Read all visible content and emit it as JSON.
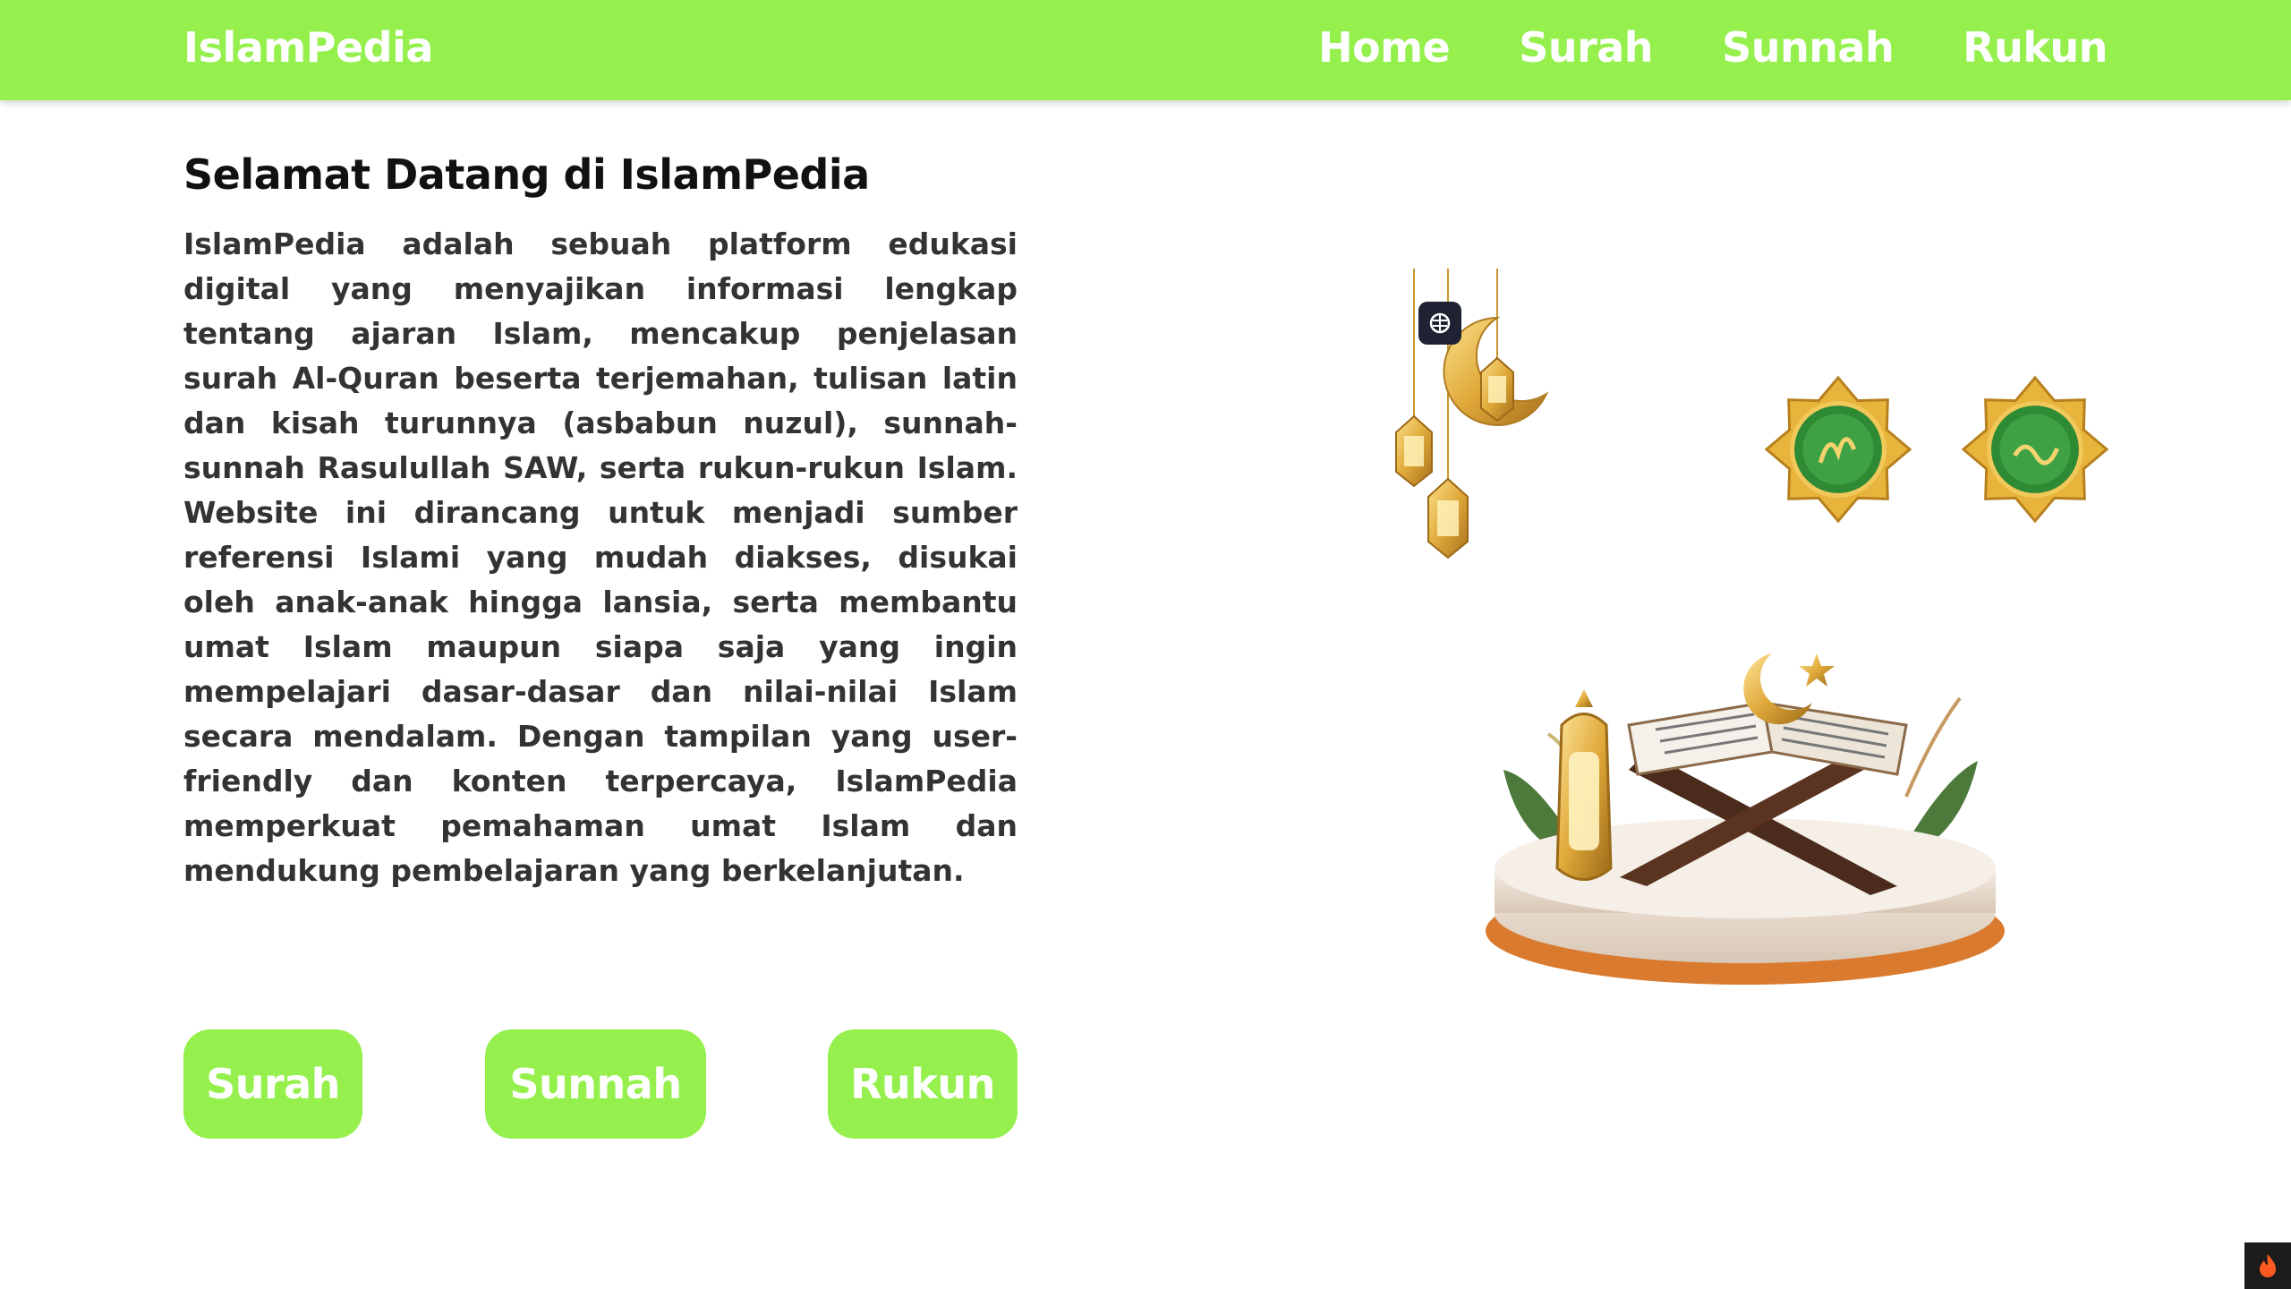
{
  "header": {
    "brand": "IslamPedia",
    "nav": [
      {
        "label": "Home"
      },
      {
        "label": "Surah"
      },
      {
        "label": "Sunnah"
      },
      {
        "label": "Rukun"
      }
    ]
  },
  "main": {
    "title": "Selamat Datang di IslamPedia",
    "paragraph": "IslamPedia adalah sebuah platform edukasi digital yang menyajikan informasi lengkap tentang ajaran Islam, mencakup penjelasan surah Al-Quran beserta terjemahan, tulisan latin dan kisah turunnya (asbabun nuzul), sunnah-sunnah Rasulullah SAW, serta rukun-rukun Islam. Website ini dirancang untuk menjadi sumber referensi Islami yang mudah diakses, disukai oleh anak-anak hingga lansia, serta membantu umat Islam maupun siapa saja yang ingin mempelajari dasar-dasar dan nilai-nilai Islam secara mendalam. Dengan tampilan yang user-friendly dan konten terpercaya, IslamPedia memperkuat pemahaman umat Islam dan mendukung pembelajaran yang berkelanjutan.",
    "buttons": [
      {
        "label": "Surah"
      },
      {
        "label": "Sunnah"
      },
      {
        "label": "Rukun"
      }
    ]
  },
  "colors": {
    "accent": "#95f04e",
    "text": "#333333",
    "gold": "#e0a93a",
    "badge_green": "#2f8a34"
  },
  "icons": {
    "lanterns": "hanging-crescent-lanterns-illustration",
    "badge_1": "allah-calligraphy-badge",
    "badge_2": "muhammad-calligraphy-badge",
    "scene": "quran-on-stand-illustration",
    "floating": "extension-icon",
    "corner": "flame-icon"
  }
}
